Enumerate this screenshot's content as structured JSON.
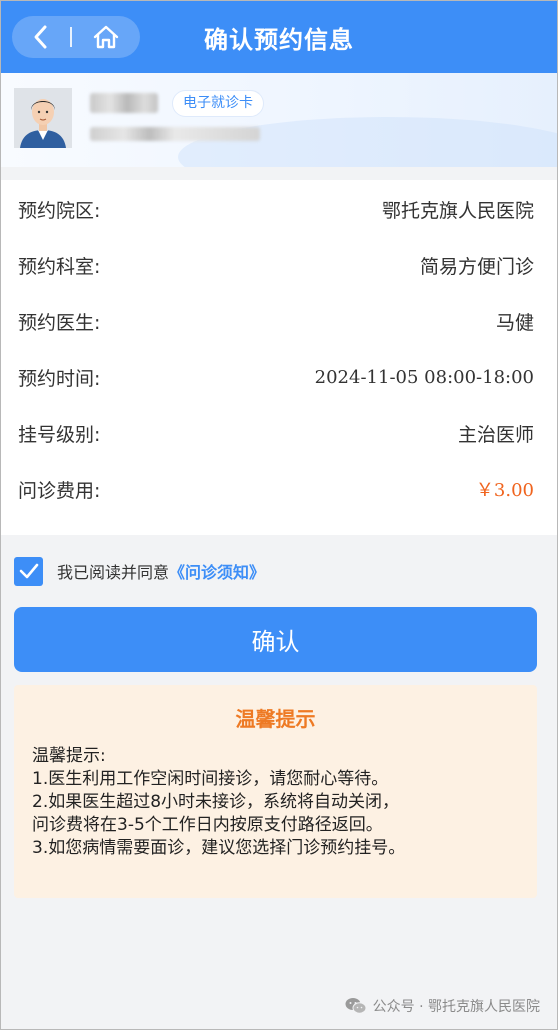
{
  "header": {
    "title": "确认预约信息",
    "back_icon": "chevron-left-icon",
    "home_icon": "home-icon"
  },
  "patient": {
    "card_label": "电子就诊卡"
  },
  "appointment": {
    "rows": [
      {
        "label": "预约院区:",
        "value": "鄂托克旗人民医院"
      },
      {
        "label": "预约科室:",
        "value": "简易方便门诊"
      },
      {
        "label": "预约医生:",
        "value": "马健"
      },
      {
        "label": "预约时间:",
        "value": "2024-11-05 08:00-18:00"
      },
      {
        "label": "挂号级别:",
        "value": "主治医师"
      },
      {
        "label": "问诊费用:",
        "value": "￥3.00"
      }
    ]
  },
  "agreement": {
    "checked": true,
    "text": "我已阅读并同意",
    "link": "《问诊须知》"
  },
  "confirm_label": "确认",
  "tips": {
    "title": "温馨提示",
    "heading": "温馨提示:",
    "lines": [
      "1.医生利用工作空闲时间接诊，请您耐心等待。",
      "2.如果医生超过8小时未接诊，系统将自动关闭，",
      "问诊费将在3-5个工作日内按原支付路径返回。",
      "3.如您病情需要面诊，建议您选择门诊预约挂号。"
    ]
  },
  "footer": {
    "text": "公众号 · 鄂托克旗人民医院",
    "icon": "wechat-icon"
  },
  "colors": {
    "primary": "#3d8ef7",
    "fee": "#f0641e",
    "tips_bg": "#fdf1e3",
    "tips_title": "#ee7a24"
  }
}
